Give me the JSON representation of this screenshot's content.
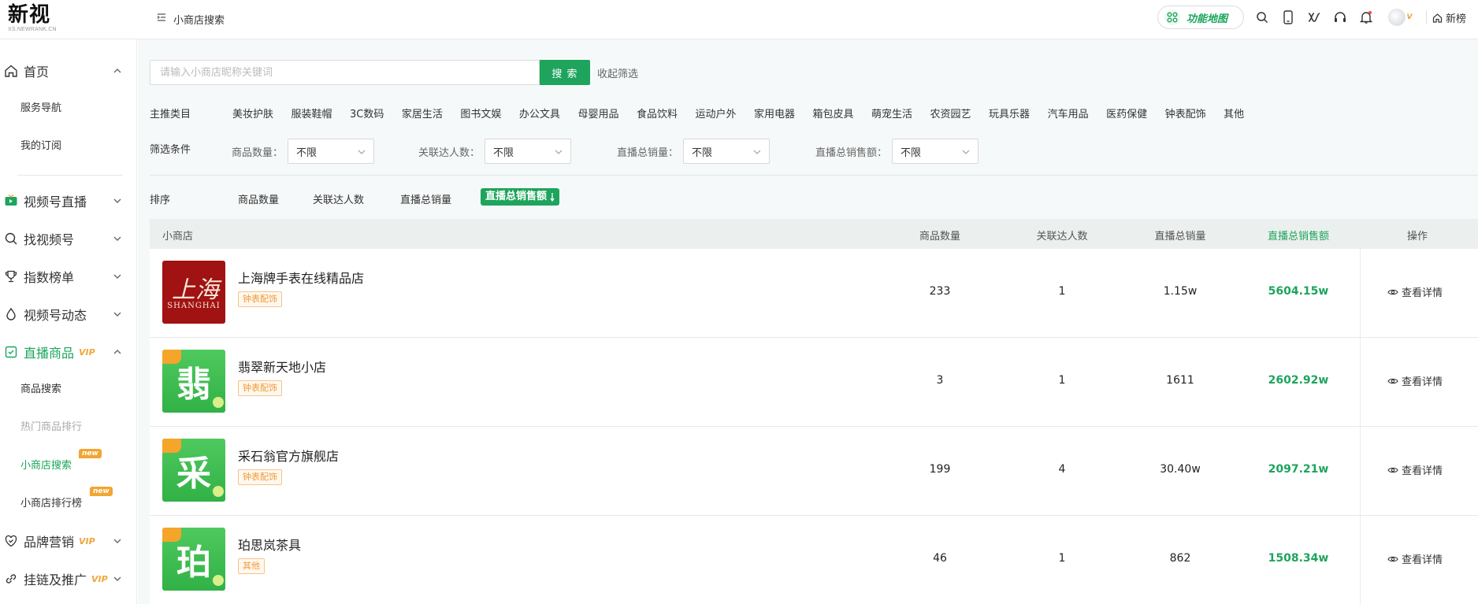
{
  "brand": {
    "logo_text": "新视",
    "logo_sub": "XS.NEWRANK.CN"
  },
  "header": {
    "breadcrumb": "小商店搜索",
    "function_map": "功能地图",
    "vip_mark": "V",
    "home_link": "新榜"
  },
  "sidebar": {
    "home": "首页",
    "home_children": [
      "服务导航",
      "我的订阅"
    ],
    "sections": [
      {
        "label": "视频号直播"
      },
      {
        "label": "找视频号"
      },
      {
        "label": "指数榜单"
      },
      {
        "label": "视频号动态"
      }
    ],
    "live_goods": {
      "label": "直播商品",
      "vip": "VIP"
    },
    "live_goods_children": [
      {
        "label": "商品搜索"
      },
      {
        "label": "热门商品排行"
      },
      {
        "label": "小商店搜索",
        "badge": "new"
      },
      {
        "label": "小商店排行榜",
        "badge": "new"
      }
    ],
    "brand_marketing": {
      "label": "品牌营销",
      "vip": "VIP"
    },
    "link_promo": {
      "label": "挂链及推广",
      "vip": "VIP"
    }
  },
  "search": {
    "placeholder": "请输入小商店昵称关键词",
    "button": "搜 索",
    "collapse": "收起筛选"
  },
  "filters": {
    "category_label": "主推类目",
    "categories": [
      "美妆护肤",
      "服装鞋帽",
      "3C数码",
      "家居生活",
      "图书文娱",
      "办公文具",
      "母婴用品",
      "食品饮料",
      "运动户外",
      "家用电器",
      "箱包皮具",
      "萌宠生活",
      "农资园艺",
      "玩具乐器",
      "汽车用品",
      "医药保健",
      "钟表配饰",
      "其他"
    ],
    "condition_label": "筛选条件",
    "conditions": [
      {
        "label": "商品数量：",
        "value": "不限"
      },
      {
        "label": "关联达人数：",
        "value": "不限"
      },
      {
        "label": "直播总销量：",
        "value": "不限"
      },
      {
        "label": "直播总销售额：",
        "value": "不限"
      }
    ]
  },
  "sort": {
    "label": "排序",
    "options": [
      "商品数量",
      "关联达人数",
      "直播总销量"
    ],
    "active": "直播总销售额"
  },
  "table": {
    "headers": [
      "小商店",
      "商品数量",
      "关联达人数",
      "直播总销量",
      "直播总销售额",
      "操作"
    ],
    "rows": [
      {
        "name": "上海牌手表在线精品店",
        "tag": "钟表配饰",
        "thumb_glyph": "上海",
        "thumb_text": "SHANGHAI",
        "count": "233",
        "influencers": "1",
        "sales": "1.15w",
        "revenue": "5604.15w",
        "action": "查看详情"
      },
      {
        "name": "翡翠新天地小店",
        "tag": "钟表配饰",
        "thumb_glyph": "翡",
        "count": "3",
        "influencers": "1",
        "sales": "1611",
        "revenue": "2602.92w",
        "action": "查看详情"
      },
      {
        "name": "采石翁官方旗舰店",
        "tag": "钟表配饰",
        "thumb_glyph": "采",
        "count": "199",
        "influencers": "4",
        "sales": "30.40w",
        "revenue": "2097.21w",
        "action": "查看详情"
      },
      {
        "name": "珀思岚茶具",
        "tag": "其他",
        "thumb_glyph": "珀",
        "count": "46",
        "influencers": "1",
        "sales": "862",
        "revenue": "1508.34w",
        "action": "查看详情"
      }
    ]
  },
  "colors": {
    "accent": "#1ea45c",
    "tag_orange": "#f09a35",
    "vip_gold": "#f0a63c"
  }
}
